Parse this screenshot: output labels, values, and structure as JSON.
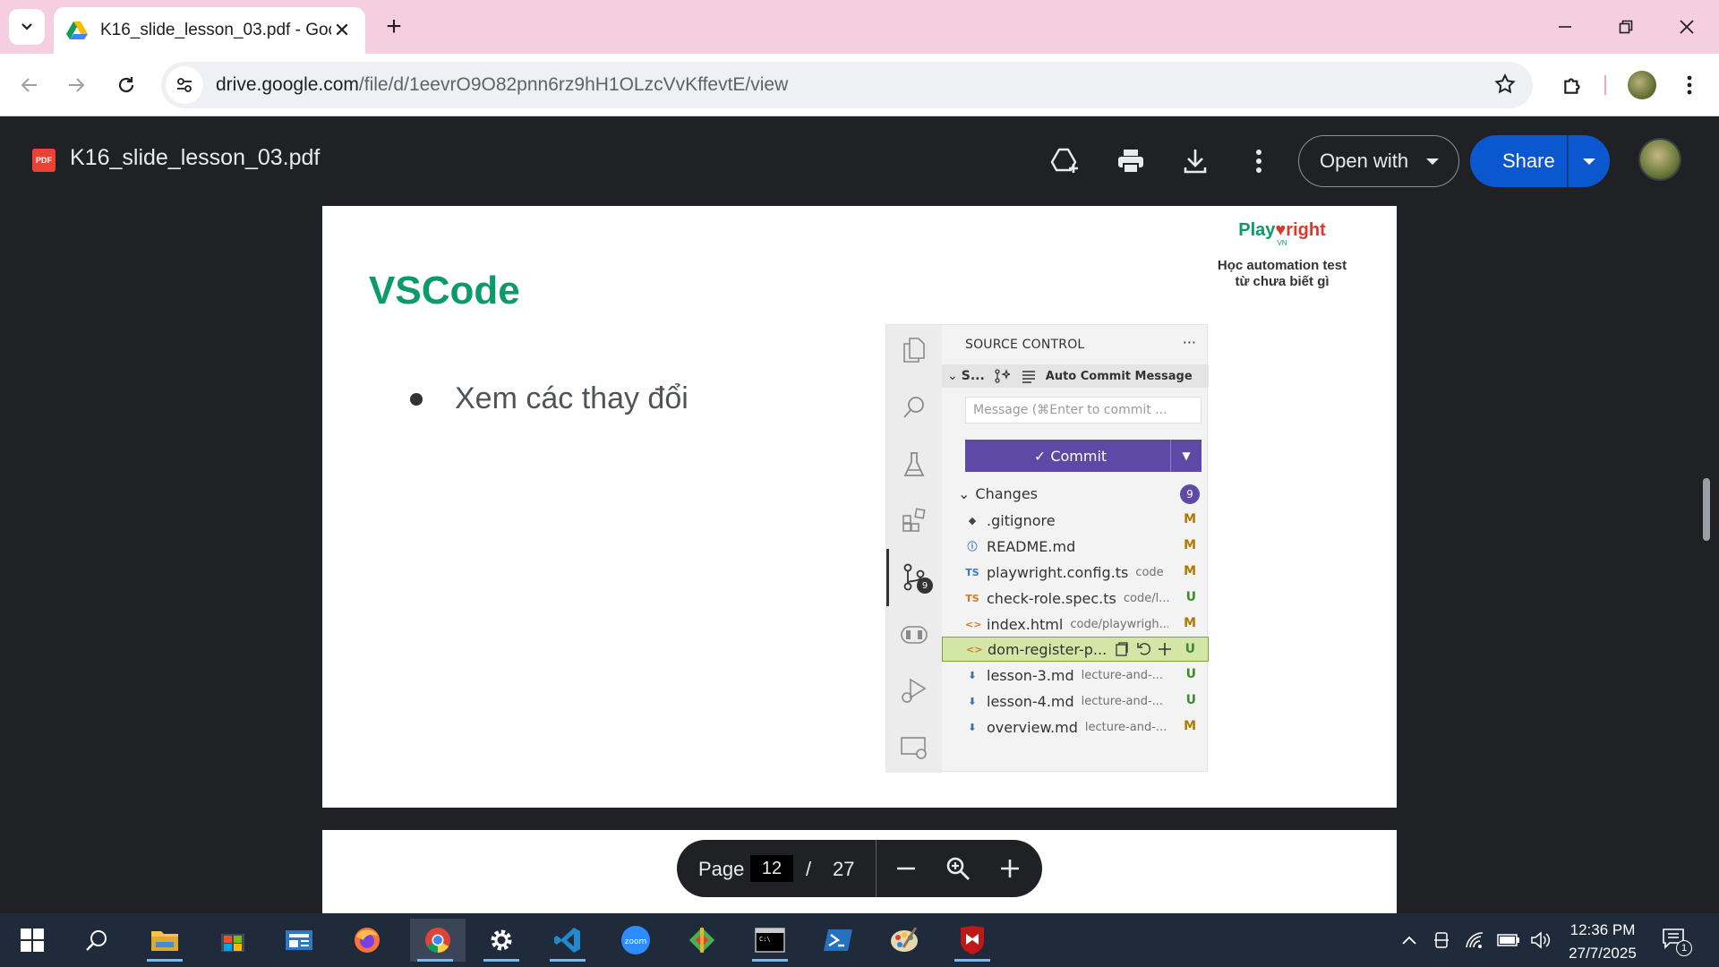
{
  "browser": {
    "tab": {
      "title": "K16_slide_lesson_03.pdf - Goog"
    },
    "address": {
      "host": "drive.google.com",
      "path": "/file/d/1eevrO9O82pnn6rz9hH1OLzcVvKffevtE/view"
    }
  },
  "drive": {
    "file_title": "K16_slide_lesson_03.pdf",
    "pdf_badge": "PDF",
    "open_with_label": "Open with",
    "share_label": "Share"
  },
  "slide": {
    "title": "VSCode",
    "bullet": "Xem các thay đổi",
    "brand": {
      "logo_left": "Play",
      "logo_right": "right",
      "logo_sub": "VN",
      "tagline_line1": "Học automation test",
      "tagline_line2": "từ chưa biết gì"
    }
  },
  "vscode": {
    "heading": "SOURCE CONTROL",
    "more": "···",
    "repo_short": "S...",
    "auto_commit": "Auto Commit Message",
    "message_placeholder": "Message (⌘Enter to commit ...",
    "commit_label": "✓ Commit",
    "activity_badge": "9",
    "changes_label": "Changes",
    "changes_count": "9",
    "files": [
      {
        "icon": "◆",
        "name": ".gitignore",
        "path": "",
        "status": "M"
      },
      {
        "icon": "ⓘ",
        "name": "README.md",
        "path": "",
        "status": "M"
      },
      {
        "icon": "TS",
        "name": "playwright.config.ts",
        "path": "code",
        "status": "M"
      },
      {
        "icon": "TS",
        "name": "check-role.spec.ts",
        "path": "code/l...",
        "status": "U"
      },
      {
        "icon": "<>",
        "name": "index.html",
        "path": "code/playwrigh...",
        "status": "M"
      },
      {
        "icon": "<>",
        "name": "dom-register-p...",
        "path": "",
        "status": "U"
      },
      {
        "icon": "⬇",
        "name": "lesson-3.md",
        "path": "lecture-and-...",
        "status": "U"
      },
      {
        "icon": "⬇",
        "name": "lesson-4.md",
        "path": "lecture-and-...",
        "status": "U"
      },
      {
        "icon": "⬇",
        "name": "overview.md",
        "path": "lecture-and-...",
        "status": "M"
      }
    ]
  },
  "page_controls": {
    "label": "Page",
    "current": "12",
    "slash": "/",
    "total": "27"
  },
  "taskbar": {
    "clock_time": "12:36 PM",
    "clock_date": "27/7/2025",
    "notification_count": "1"
  },
  "colors": {
    "tab_strip": "#f5cfe0",
    "share_blue": "#0b57d0",
    "slide_green": "#0b9b68",
    "commit_purple": "#5e4aa6",
    "viewer_bg": "#202124",
    "taskbar_bg": "#1f2b3b"
  }
}
